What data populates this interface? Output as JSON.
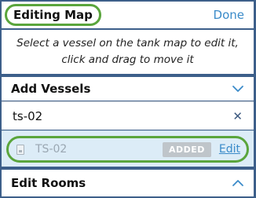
{
  "header": {
    "title": "Editing Map",
    "done_label": "Done"
  },
  "instructions": "Select a vessel on the tank map to edit it, click and drag to move it",
  "add_vessels": {
    "title": "Add Vessels",
    "chevron": "chevron-down-icon",
    "search_value": "ts-02",
    "clear_icon": "close-icon",
    "clear_glyph": "✕",
    "result": {
      "name": "TS-02",
      "badge": "ADDED",
      "edit_label": "Edit",
      "icon": "vessel-icon"
    }
  },
  "edit_rooms": {
    "title": "Edit Rooms",
    "chevron": "chevron-up-icon"
  },
  "colors": {
    "accent": "#3b8bc9",
    "highlight": "#5aa53c",
    "background": "#3d5f8a",
    "result_bg": "#dcecf7"
  }
}
